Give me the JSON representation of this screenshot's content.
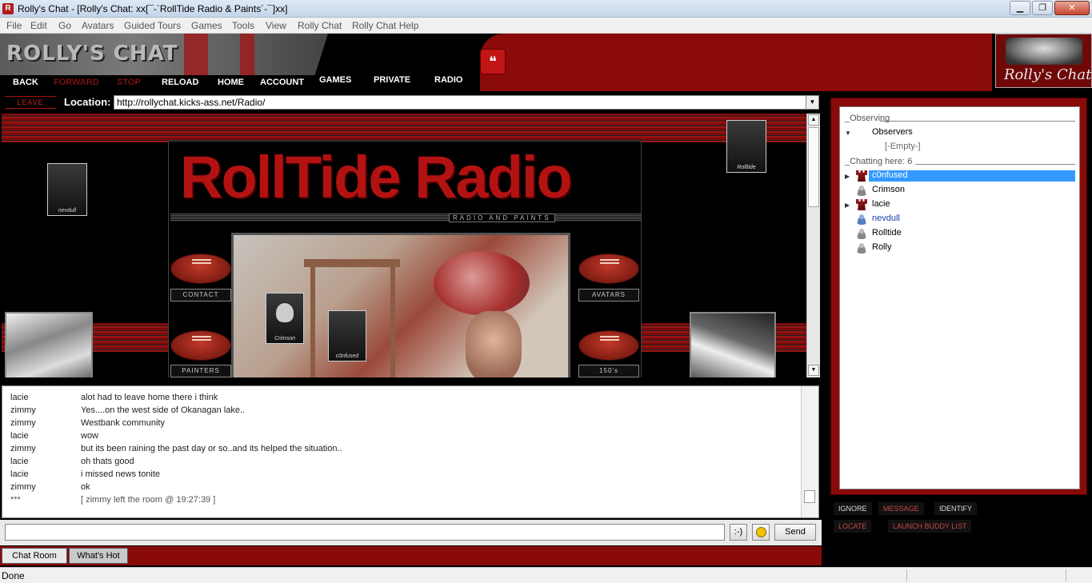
{
  "window": {
    "title": "Rolly's Chat - [Rolly's Chat: xx[¯-`RollTide Radio & Paints´-¯]xx]",
    "min": "▁",
    "max": "❐",
    "close": "✕"
  },
  "menu": [
    "File",
    "Edit",
    "Go",
    "Avatars",
    "Guided Tours",
    "Games",
    "Tools",
    "View",
    "Rolly Chat",
    "Rolly Chat Help"
  ],
  "banner": {
    "logo_text": "ROLLY'S CHAT",
    "nav": [
      "BACK",
      "FORWARD",
      "STOP",
      "RELOAD",
      "HOME",
      "ACCOUNT",
      "GAMES",
      "PRIVATE",
      "RADIO"
    ],
    "corner_logo": "Rolly's Chat",
    "chat_icon": "❝"
  },
  "location": {
    "leave_label": "LEAVE",
    "label": "Location:",
    "url": "http://rollychat.kicks-ass.net/Radio/",
    "dropdown": "▼"
  },
  "web": {
    "title": "RollTide Radio",
    "subtitle": "RADIO AND PAINTS",
    "buttons": {
      "contact": "CONTACT",
      "avatars": "AVATARS",
      "painters": "PAINTERS",
      "s150": "150's"
    },
    "thumb_caps": {
      "crimson": "Crimson",
      "top_right": "Rolltide",
      "left": "nevdull",
      "mid": "c0nfused"
    },
    "scroll_up": "▲",
    "scroll_down": "▼"
  },
  "chat": {
    "messages": [
      {
        "name": "lacie",
        "text": "alot had to leave home there i think"
      },
      {
        "name": "zimmy",
        "text": "Yes....on the west side of Okanagan lake.."
      },
      {
        "name": "zimmy",
        "text": "Westbank community"
      },
      {
        "name": "lacie",
        "text": "wow"
      },
      {
        "name": "zimmy",
        "text": "but its been raining the past day or so..and its helped the situation.."
      },
      {
        "name": "lacie",
        "text": "oh thats good"
      },
      {
        "name": "lacie",
        "text": "i missed news tonite"
      },
      {
        "name": "zimmy",
        "text": "ok"
      },
      {
        "name": "***",
        "text": "[ zimmy left the room @ 19:27:39 ]"
      }
    ],
    "emote_label": ":-)",
    "send_label": "Send",
    "tabs": [
      "Chat Room",
      "What's Hot"
    ]
  },
  "users_panel": {
    "observing_header": "_Observing",
    "observers_label": "Observers",
    "observers_empty": "[-Empty-]",
    "chatting_header": "_Chatting here: 6",
    "users": [
      {
        "name": "c0nfused",
        "icon": "rook-icon",
        "selected": true,
        "expand": true
      },
      {
        "name": "Crimson",
        "icon": "person-icon",
        "selected": false,
        "expand": false
      },
      {
        "name": "lacie",
        "icon": "rook-icon",
        "selected": false,
        "expand": true
      },
      {
        "name": "nevdull",
        "icon": "person-blue-icon",
        "selected": false,
        "expand": false
      },
      {
        "name": "Rolltide",
        "icon": "person-icon",
        "selected": false,
        "expand": false
      },
      {
        "name": "Rolly",
        "icon": "person-icon",
        "selected": false,
        "expand": false
      }
    ],
    "actions": {
      "ignore": "IGNORE",
      "message": "MESSAGE",
      "identify": "IDENTIFY",
      "locate": "LOCATE",
      "buddy": "LAUNCH BUDDY LIST"
    }
  },
  "status": {
    "text": "Done"
  },
  "colors": {
    "accent_red": "#8b0a0a",
    "selection": "#3399ff",
    "nevdull_name": "#1a3fb0"
  }
}
